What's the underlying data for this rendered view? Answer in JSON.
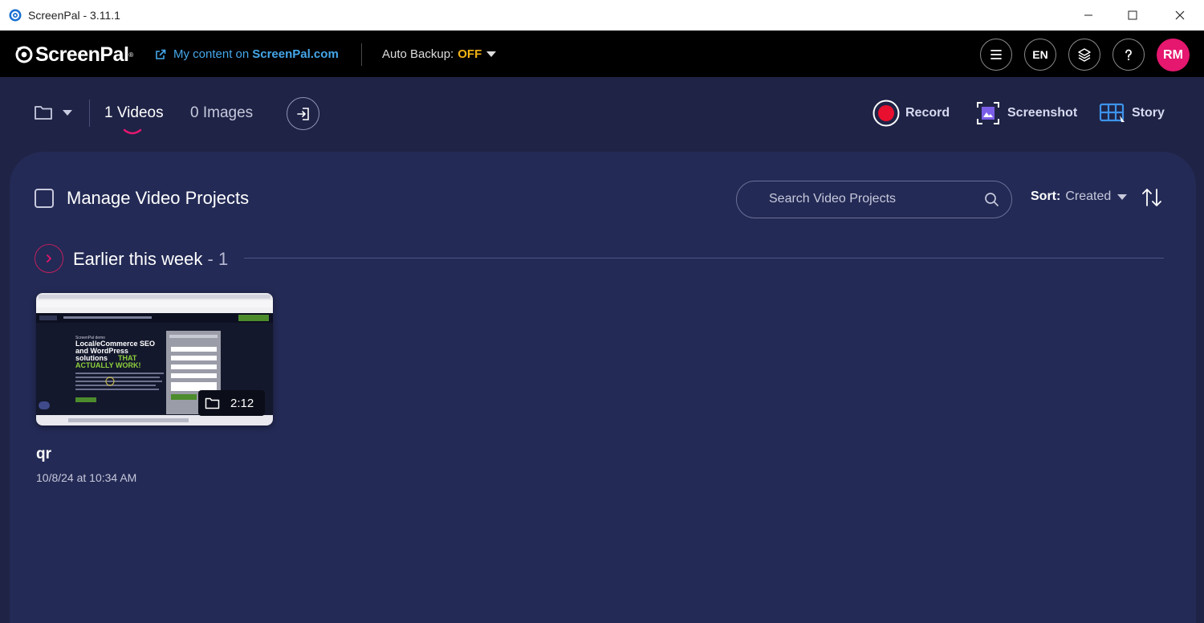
{
  "window": {
    "title": "ScreenPal - 3.11.1"
  },
  "appbar": {
    "logo_text": "ScreenPal",
    "my_content_prefix": "My content on",
    "my_content_site": "ScreenPal.com",
    "auto_backup_label": "Auto Backup:",
    "auto_backup_value": "OFF",
    "language": "EN",
    "avatar_initials": "RM"
  },
  "toolbar": {
    "tab_videos": "1 Videos",
    "tab_images": "0 Images",
    "record_label": "Record",
    "screenshot_label": "Screenshot",
    "story_label": "Story"
  },
  "main": {
    "manage_title": "Manage Video Projects",
    "search_placeholder": "Search Video Projects",
    "sort_label": "Sort:",
    "sort_value": "Created",
    "group": {
      "title": "Earlier this week",
      "count": " - 1"
    },
    "videos": [
      {
        "name": "qr",
        "date": "10/8/24 at 10:34 AM",
        "duration": "2:12",
        "thumbnail": {
          "headline": [
            "Local/eCommerce SEO",
            "and WordPress",
            "solutions"
          ],
          "highlight_words": "THAT",
          "highlight_line2": "ACTUALLY WORK!"
        }
      }
    ]
  },
  "colors": {
    "background": "#1f2346",
    "panel": "#232a55",
    "accent_link": "#45a7ea",
    "backup_off": "#f5b515",
    "avatar": "#e5176f",
    "record": "#e8102e"
  }
}
